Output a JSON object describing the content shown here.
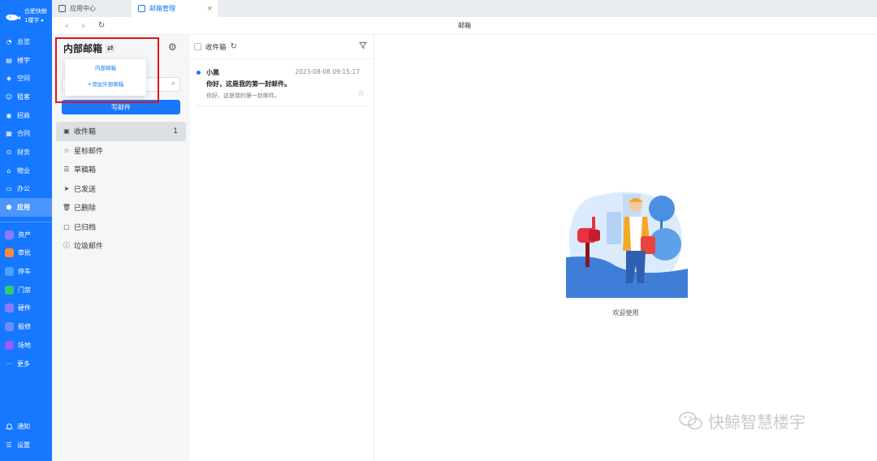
{
  "brand": {
    "name": "合肥快鲸",
    "building": "1楼宇"
  },
  "nav": {
    "main": [
      {
        "label": "总览",
        "icon": "dashboard-icon"
      },
      {
        "label": "楼宇",
        "icon": "building-icon"
      },
      {
        "label": "空间",
        "icon": "cube-icon"
      },
      {
        "label": "租客",
        "icon": "tenant-icon"
      },
      {
        "label": "招商",
        "icon": "investment-icon"
      },
      {
        "label": "合同",
        "icon": "contract-icon"
      },
      {
        "label": "财务",
        "icon": "finance-icon"
      },
      {
        "label": "物业",
        "icon": "property-icon"
      },
      {
        "label": "办公",
        "icon": "office-icon"
      },
      {
        "label": "应用",
        "icon": "app-icon"
      }
    ],
    "apps": [
      {
        "label": "资产"
      },
      {
        "label": "审批"
      },
      {
        "label": "停车"
      },
      {
        "label": "门禁"
      },
      {
        "label": "硬件"
      },
      {
        "label": "报修"
      },
      {
        "label": "场地"
      }
    ],
    "more": "更多",
    "bottom": [
      {
        "label": "通知"
      },
      {
        "label": "设置"
      }
    ]
  },
  "tabs": [
    {
      "label": "应用中心"
    },
    {
      "label": "邮箱管理"
    }
  ],
  "toolbar": {
    "title": "邮箱"
  },
  "mailbox": {
    "title": "内部邮箱",
    "popup_options": [
      "内部邮箱",
      "+添加外部邮箱"
    ],
    "compose": "写邮件",
    "folders": [
      {
        "label": "收件箱",
        "count": "1"
      },
      {
        "label": "星标邮件"
      },
      {
        "label": "草稿箱"
      },
      {
        "label": "已发送"
      },
      {
        "label": "已删除"
      },
      {
        "label": "已归档"
      },
      {
        "label": "垃圾邮件"
      }
    ]
  },
  "maillist": {
    "title": "收件箱",
    "mails": [
      {
        "from": "小黑",
        "time": "2023-08-08 09:15:17",
        "subject": "你好，这是我的第一封邮件。",
        "preview": "你好，这是我的第一封邮件。"
      }
    ]
  },
  "detail": {
    "welcome": "欢迎使用"
  },
  "watermark": "快鲸智慧楼宇",
  "colors": {
    "primary": "#1677ff",
    "highlight": "#e0161c"
  }
}
